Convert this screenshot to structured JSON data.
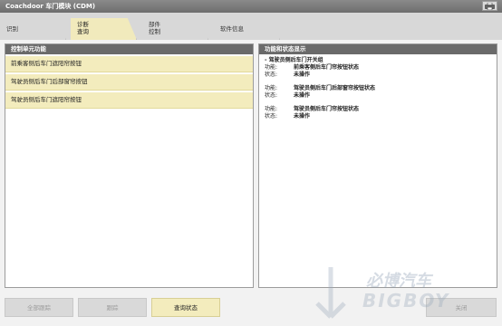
{
  "window": {
    "title": "Coachdoor 车门模块 (CDM)",
    "print_icon": "printer-icon"
  },
  "tabs": [
    {
      "line1": "识别",
      "line2": ""
    },
    {
      "line1": "诊断",
      "line2": "查询"
    },
    {
      "line1": "部件",
      "line2": "控制"
    },
    {
      "line1": "软件信息",
      "line2": ""
    }
  ],
  "left_panel": {
    "header": "控制单元功能",
    "items": [
      "前乘客侧后车门遮阳帘按钮",
      "驾驶员侧后车门后部窗帘按钮",
      "驾驶员侧后车门遮阳帘按钮"
    ]
  },
  "right_panel": {
    "header": "功能和状态显示",
    "section": "- 驾驶员侧后车门开关组",
    "entries": [
      {
        "function_label": "功能:",
        "function_value": "前乘客侧后车门帘按钮状态",
        "status_label": "状态:",
        "status_value": "未操作"
      },
      {
        "function_label": "功能:",
        "function_value": "驾驶员侧后车门后部窗帘按钮状态",
        "status_label": "状态:",
        "status_value": "未操作"
      },
      {
        "function_label": "功能:",
        "function_value": "驾驶员侧后车门帘按钮状态",
        "status_label": "状态:",
        "status_value": "未操作"
      }
    ]
  },
  "buttons": {
    "all_select": "全部跟踪",
    "track": "跟踪",
    "query": "查询状态",
    "close": "关闭"
  },
  "watermark": {
    "cn": "必博汽车",
    "en": "BIGBOY"
  },
  "colors": {
    "accent_yellow": "#f3ecbd",
    "header_gray": "#6a6a6a",
    "titlebar": "#7c7c7c"
  }
}
